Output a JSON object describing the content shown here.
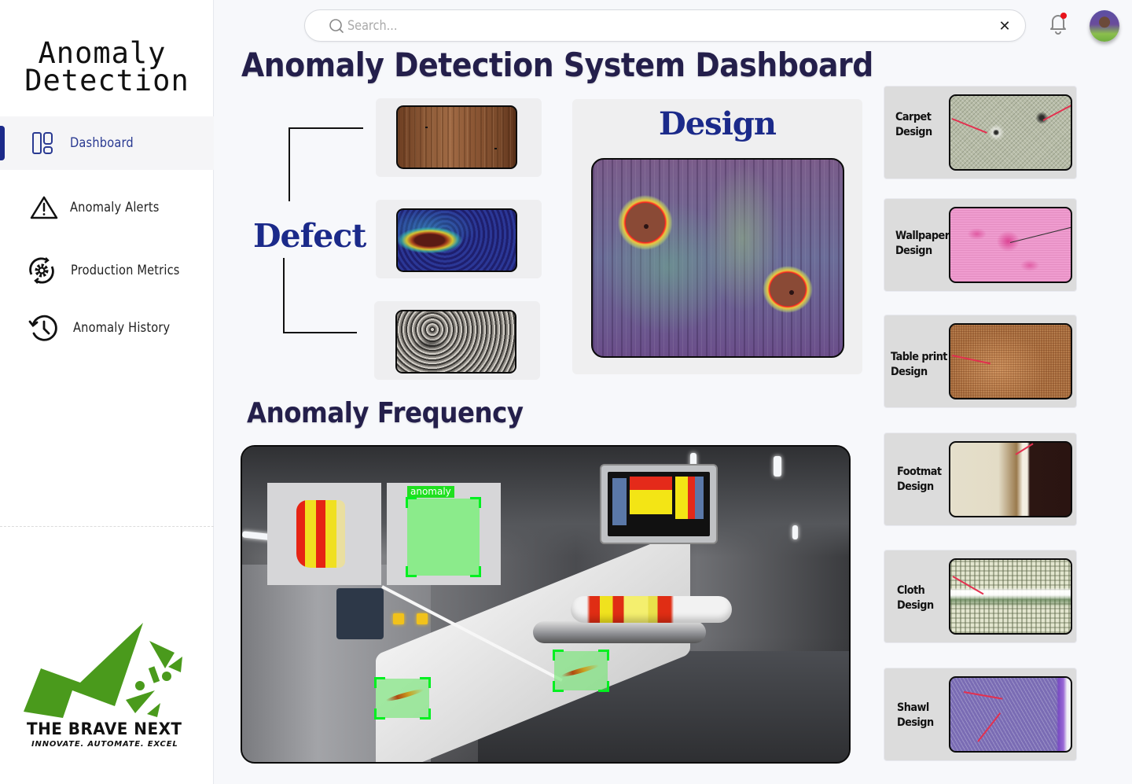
{
  "sidebar": {
    "brand_line1": "Anomaly",
    "brand_line2": "Detection",
    "items": [
      {
        "label": "Dashboard",
        "icon": "dashboard-layout-icon",
        "active": true
      },
      {
        "label": "Anomaly Alerts",
        "icon": "warning-triangle-icon",
        "active": false
      },
      {
        "label": "Production Metrics",
        "icon": "gear-cycle-icon",
        "active": false
      },
      {
        "label": "Anomaly History",
        "icon": "history-clock-icon",
        "active": false
      }
    ],
    "logo": {
      "title": "THE BRAVE NEXT",
      "tagline": "INNOVATE. AUTOMATE. EXCEL",
      "color": "#4a9a1c"
    }
  },
  "topbar": {
    "search": {
      "placeholder": "Search...",
      "value": "",
      "clear_label": "✕"
    },
    "notifications": {
      "has_unread": true,
      "dot_color": "#e8131b"
    },
    "avatar": {
      "label": "user-avatar"
    }
  },
  "main": {
    "title": "Anomaly Detection System Dashboard",
    "defect": {
      "label": "Defect",
      "samples": [
        {
          "name": "wood-grain-defect"
        },
        {
          "name": "heatmap-defect"
        },
        {
          "name": "speckled-fabric-defect"
        }
      ]
    },
    "design": {
      "label": "Design",
      "image": "wood-heatmap-two-anomalies"
    },
    "frequency": {
      "title": "Anomaly Frequency",
      "detection_tag": "anomaly"
    },
    "design_types": [
      {
        "line1": "Carpet",
        "line2": "Design",
        "texture": "carpet"
      },
      {
        "line1": "Wallpaper",
        "line2": "Design",
        "texture": "wallpaper"
      },
      {
        "line1": "Table print",
        "line2": "Design",
        "texture": "tableprint"
      },
      {
        "line1": "Footmat",
        "line2": "Design",
        "texture": "footmat"
      },
      {
        "line1": "Cloth",
        "line2": "Design",
        "texture": "cloth"
      },
      {
        "line1": "Shawl",
        "line2": "Design",
        "texture": "shawl"
      }
    ]
  },
  "colors": {
    "accent": "#1b2a8a",
    "heading": "#241f4b",
    "detection_green": "#00f020",
    "defect_pointer": "#e3304f"
  }
}
